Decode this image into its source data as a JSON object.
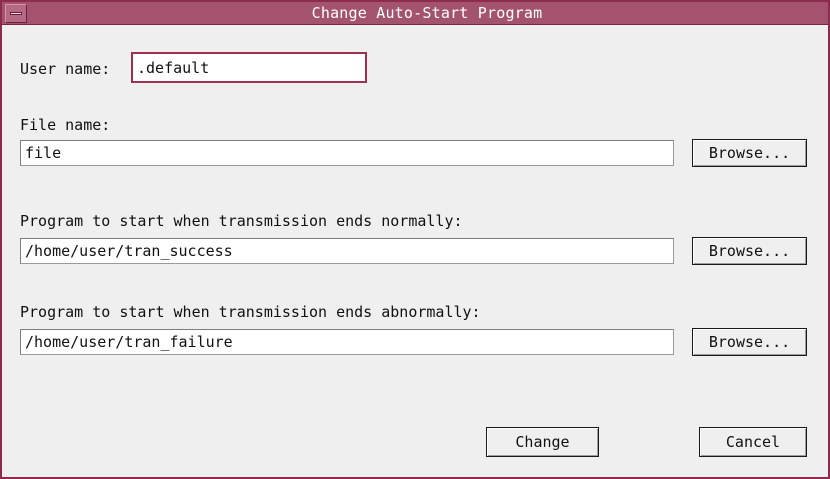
{
  "window": {
    "title": "Change Auto-Start Program",
    "titlebar_color": "#a4536f",
    "border_color": "#8d2b4f"
  },
  "user_name": {
    "label": "User name:",
    "value": ".default"
  },
  "file_name": {
    "label": "File name:",
    "value": "file",
    "browse_label": "Browse..."
  },
  "normal_program": {
    "label": "Program to start when transmission ends normally:",
    "value": "/home/user/tran_success",
    "browse_label": "Browse..."
  },
  "abnormal_program": {
    "label": "Program to start when transmission ends abnormally:",
    "value": "/home/user/tran_failure",
    "browse_label": "Browse..."
  },
  "actions": {
    "change_label": "Change",
    "cancel_label": "Cancel"
  }
}
